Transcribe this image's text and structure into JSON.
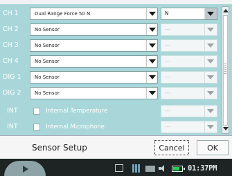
{
  "rows": [
    {
      "label": "CH 1",
      "sensor": "Dual Range Force 50 N",
      "unit": "N"
    },
    {
      "label": "CH 2",
      "sensor": "No Sensor",
      "unit": "---"
    },
    {
      "label": "CH 3",
      "sensor": "No Sensor",
      "unit": "---"
    },
    {
      "label": "CH 4",
      "sensor": "No Sensor",
      "unit": "---"
    },
    {
      "label": "DIG 1",
      "sensor": "No Sensor",
      "unit": "---"
    },
    {
      "label": "DIG 2",
      "sensor": "No Sensor",
      "unit": "---"
    }
  ],
  "internal": [
    {
      "label": "INT",
      "sensor": "Internal Temperature",
      "unit": "---",
      "checked": false
    },
    {
      "label": "INT",
      "sensor": "Internal Microphone",
      "unit": "---",
      "checked": false
    }
  ],
  "footer": {
    "title": "Sensor Setup",
    "cancel_label": "Cancel",
    "ok_label": "OK"
  },
  "taskbar": {
    "clock": "01:37PM",
    "battery_color": "#20d050"
  },
  "colors": {
    "content_bg": "#a9d7d9",
    "taskbar_bg": "#1e2324"
  }
}
